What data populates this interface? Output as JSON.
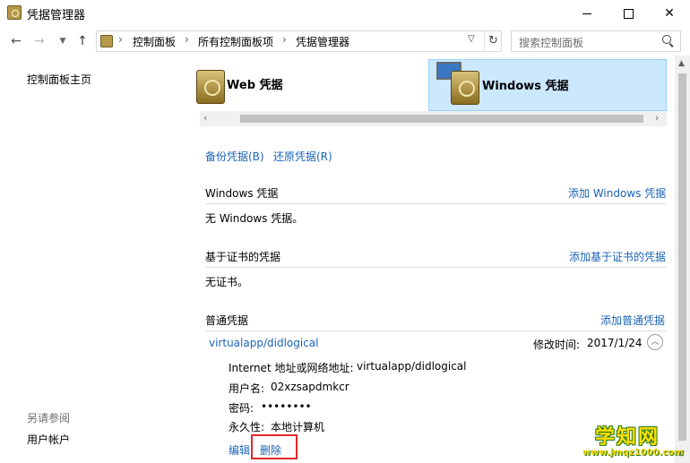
{
  "window": {
    "title": "凭据管理器"
  },
  "address": {
    "crumbs": [
      "控制面板",
      "所有控制面板项",
      "凭据管理器"
    ],
    "search_placeholder": "搜索控制面板"
  },
  "leftnav": {
    "home": "控制面板主页",
    "see_also": "另请参阅",
    "user_accounts": "用户帐户"
  },
  "tabs": [
    {
      "label": "Web 凭据",
      "selected": false
    },
    {
      "label": "Windows 凭据",
      "selected": true
    }
  ],
  "actions": {
    "backup": "备份凭据(B)",
    "restore": "还原凭据(R)"
  },
  "sections": {
    "windows": {
      "title": "Windows 凭据",
      "add": "添加 Windows 凭据",
      "empty": "无 Windows 凭据。"
    },
    "cert": {
      "title": "基于证书的凭据",
      "add": "添加基于证书的凭据",
      "empty": "无证书。"
    },
    "generic": {
      "title": "普通凭据",
      "add": "添加普通凭据",
      "item": {
        "name": "virtualapp/didlogical",
        "modified_label": "修改时间:",
        "modified": "2017/1/24",
        "address_label": "Internet 地址或网络地址:",
        "address": "virtualapp/didlogical",
        "user_label": "用户名:",
        "user": "02xzsapdmkcr",
        "password_label": "密码:",
        "password": "••••••••",
        "persist_label": "永久性:",
        "persist": "本地计算机",
        "edit": "编辑",
        "delete": "删除"
      }
    }
  },
  "watermark": {
    "logo": "学知网",
    "url": "www.jmqz1000.com"
  },
  "colors": {
    "link": "#1a64b7",
    "selected_tab": "#cce8ff",
    "highlight_box": "#e0282c"
  }
}
